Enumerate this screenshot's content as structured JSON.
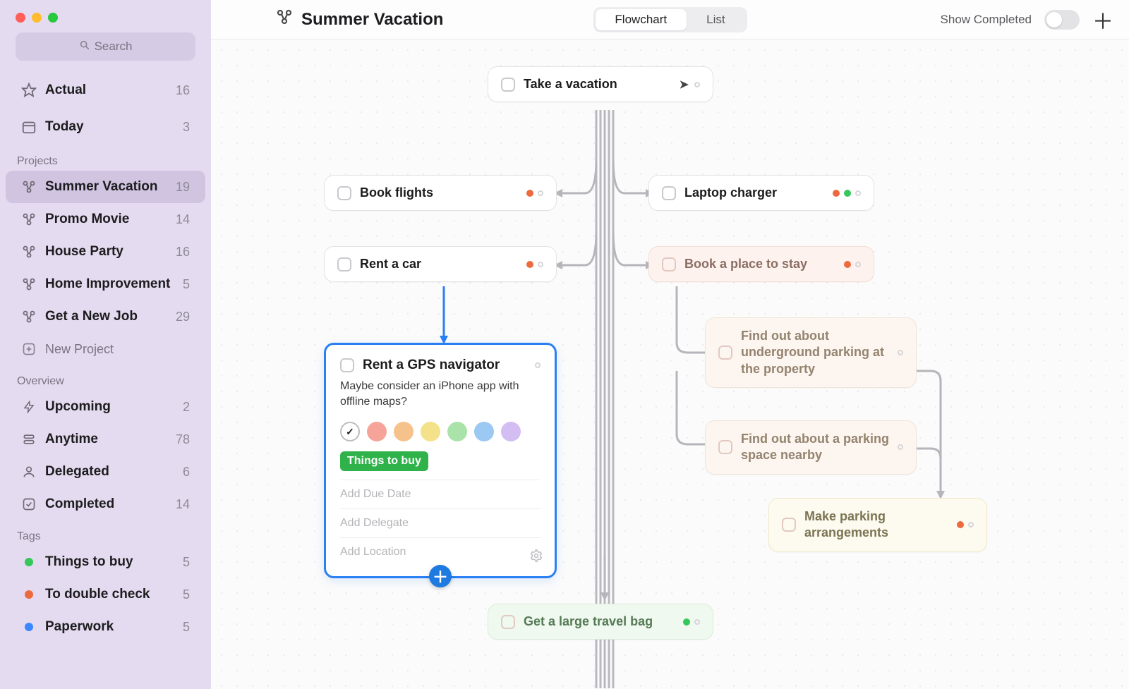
{
  "window": {
    "title": "Summer Vacation"
  },
  "sidebar": {
    "search_placeholder": "Search",
    "main": [
      {
        "icon": "star",
        "label": "Actual",
        "count": "16"
      },
      {
        "icon": "calendar",
        "label": "Today",
        "count": "3"
      }
    ],
    "projects_label": "Projects",
    "projects": [
      {
        "label": "Summer Vacation",
        "count": "19",
        "active": true
      },
      {
        "label": "Promo Movie",
        "count": "14"
      },
      {
        "label": "House Party",
        "count": "16"
      },
      {
        "label": "Home Improvement",
        "count": "5"
      },
      {
        "label": "Get a New Job",
        "count": "29"
      }
    ],
    "new_project": "New Project",
    "overview_label": "Overview",
    "overview": [
      {
        "icon": "bolt",
        "label": "Upcoming",
        "count": "2"
      },
      {
        "icon": "stack",
        "label": "Anytime",
        "count": "78"
      },
      {
        "icon": "user",
        "label": "Delegated",
        "count": "6"
      },
      {
        "icon": "check",
        "label": "Completed",
        "count": "14"
      }
    ],
    "tags_label": "Tags",
    "tags": [
      {
        "color": "#34c759",
        "label": "Things to buy",
        "count": "5"
      },
      {
        "color": "#ed6a3e",
        "label": "To double check",
        "count": "5"
      },
      {
        "color": "#3a87ff",
        "label": "Paperwork",
        "count": "5"
      }
    ]
  },
  "header": {
    "view_flowchart": "Flowchart",
    "view_list": "List",
    "show_completed": "Show Completed"
  },
  "cards": {
    "root": "Take a vacation",
    "book_flights": "Book flights",
    "laptop_charger": "Laptop charger",
    "rent_car": "Rent a car",
    "book_place": "Book a place to stay",
    "underground": "Find out about underground parking at the property",
    "nearby": "Find out about a parking space nearby",
    "make_parking": "Make parking arrangements",
    "travel_bag": "Get a large travel bag"
  },
  "editor": {
    "title": "Rent a GPS navigator",
    "note": "Maybe consider an iPhone app with offline maps?",
    "swatches": [
      "#ffffff",
      "#f6a49a",
      "#f6c28b",
      "#f4e28b",
      "#a9e3a9",
      "#9cc8f4",
      "#d3bdf2"
    ],
    "tag": "Things to buy",
    "fields": {
      "due": "Add Due Date",
      "delegate": "Add Delegate",
      "location": "Add Location"
    }
  }
}
